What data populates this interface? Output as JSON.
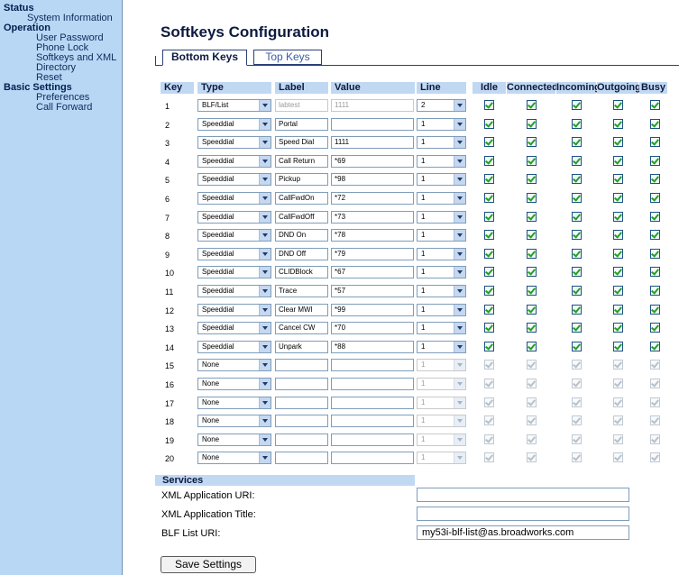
{
  "sidebar": {
    "status": "Status",
    "system_information": "System Information",
    "operation": "Operation",
    "user_password": "User Password",
    "phone_lock": "Phone Lock",
    "softkeys_xml": "Softkeys and XML",
    "directory": "Directory",
    "reset": "Reset",
    "basic_settings": "Basic Settings",
    "preferences": "Preferences",
    "call_forward": "Call Forward"
  },
  "page_title": "Softkeys Configuration",
  "tabs": {
    "bottom": "Bottom Keys",
    "top": "Top Keys"
  },
  "headers": [
    "Key",
    "Type",
    "Label",
    "Value",
    "Line",
    "Idle",
    "Connected",
    "Incoming",
    "Outgoing",
    "Busy"
  ],
  "rows": [
    {
      "key": "1",
      "type": "BLF/List",
      "label": "",
      "label_placeholder": "labtest",
      "value": "",
      "value_placeholder": "1111",
      "line": "2",
      "enabled": true
    },
    {
      "key": "2",
      "type": "Speeddial",
      "label": "Portal",
      "value": "",
      "line": "1",
      "enabled": true
    },
    {
      "key": "3",
      "type": "Speeddial",
      "label": "Speed Dial",
      "value": "1111",
      "line": "1",
      "enabled": true
    },
    {
      "key": "4",
      "type": "Speeddial",
      "label": "Call Return",
      "value": "*69",
      "line": "1",
      "enabled": true
    },
    {
      "key": "5",
      "type": "Speeddial",
      "label": "Pickup",
      "value": "*98",
      "line": "1",
      "enabled": true
    },
    {
      "key": "6",
      "type": "Speeddial",
      "label": "CallFwdOn",
      "value": "*72",
      "line": "1",
      "enabled": true
    },
    {
      "key": "7",
      "type": "Speeddial",
      "label": "CallFwdOff",
      "value": "*73",
      "line": "1",
      "enabled": true
    },
    {
      "key": "8",
      "type": "Speeddial",
      "label": "DND On",
      "value": "*78",
      "line": "1",
      "enabled": true
    },
    {
      "key": "9",
      "type": "Speeddial",
      "label": "DND Off",
      "value": "*79",
      "line": "1",
      "enabled": true
    },
    {
      "key": "10",
      "type": "Speeddial",
      "label": "CLIDBlock",
      "value": "*67",
      "line": "1",
      "enabled": true
    },
    {
      "key": "11",
      "type": "Speeddial",
      "label": "Trace",
      "value": "*57",
      "line": "1",
      "enabled": true
    },
    {
      "key": "12",
      "type": "Speeddial",
      "label": "Clear MWI",
      "value": "*99",
      "line": "1",
      "enabled": true
    },
    {
      "key": "13",
      "type": "Speeddial",
      "label": "Cancel CW",
      "value": "*70",
      "line": "1",
      "enabled": true
    },
    {
      "key": "14",
      "type": "Speeddial",
      "label": "Unpark",
      "value": "*88",
      "line": "1",
      "enabled": true
    },
    {
      "key": "15",
      "type": "None",
      "label": "",
      "value": "",
      "line": "1",
      "enabled": false
    },
    {
      "key": "16",
      "type": "None",
      "label": "",
      "value": "",
      "line": "1",
      "enabled": false
    },
    {
      "key": "17",
      "type": "None",
      "label": "",
      "value": "",
      "line": "1",
      "enabled": false
    },
    {
      "key": "18",
      "type": "None",
      "label": "",
      "value": "",
      "line": "1",
      "enabled": false
    },
    {
      "key": "19",
      "type": "None",
      "label": "",
      "value": "",
      "line": "1",
      "enabled": false
    },
    {
      "key": "20",
      "type": "None",
      "label": "",
      "value": "",
      "line": "1",
      "enabled": false
    }
  ],
  "services": {
    "header": "Services",
    "xml_uri_label": "XML Application URI:",
    "xml_uri_value": "",
    "xml_title_label": "XML Application Title:",
    "xml_title_value": "",
    "blf_label": "BLF List URI:",
    "blf_value": "my53i-blf-list@as.broadworks.com"
  },
  "save_button": "Save Settings"
}
